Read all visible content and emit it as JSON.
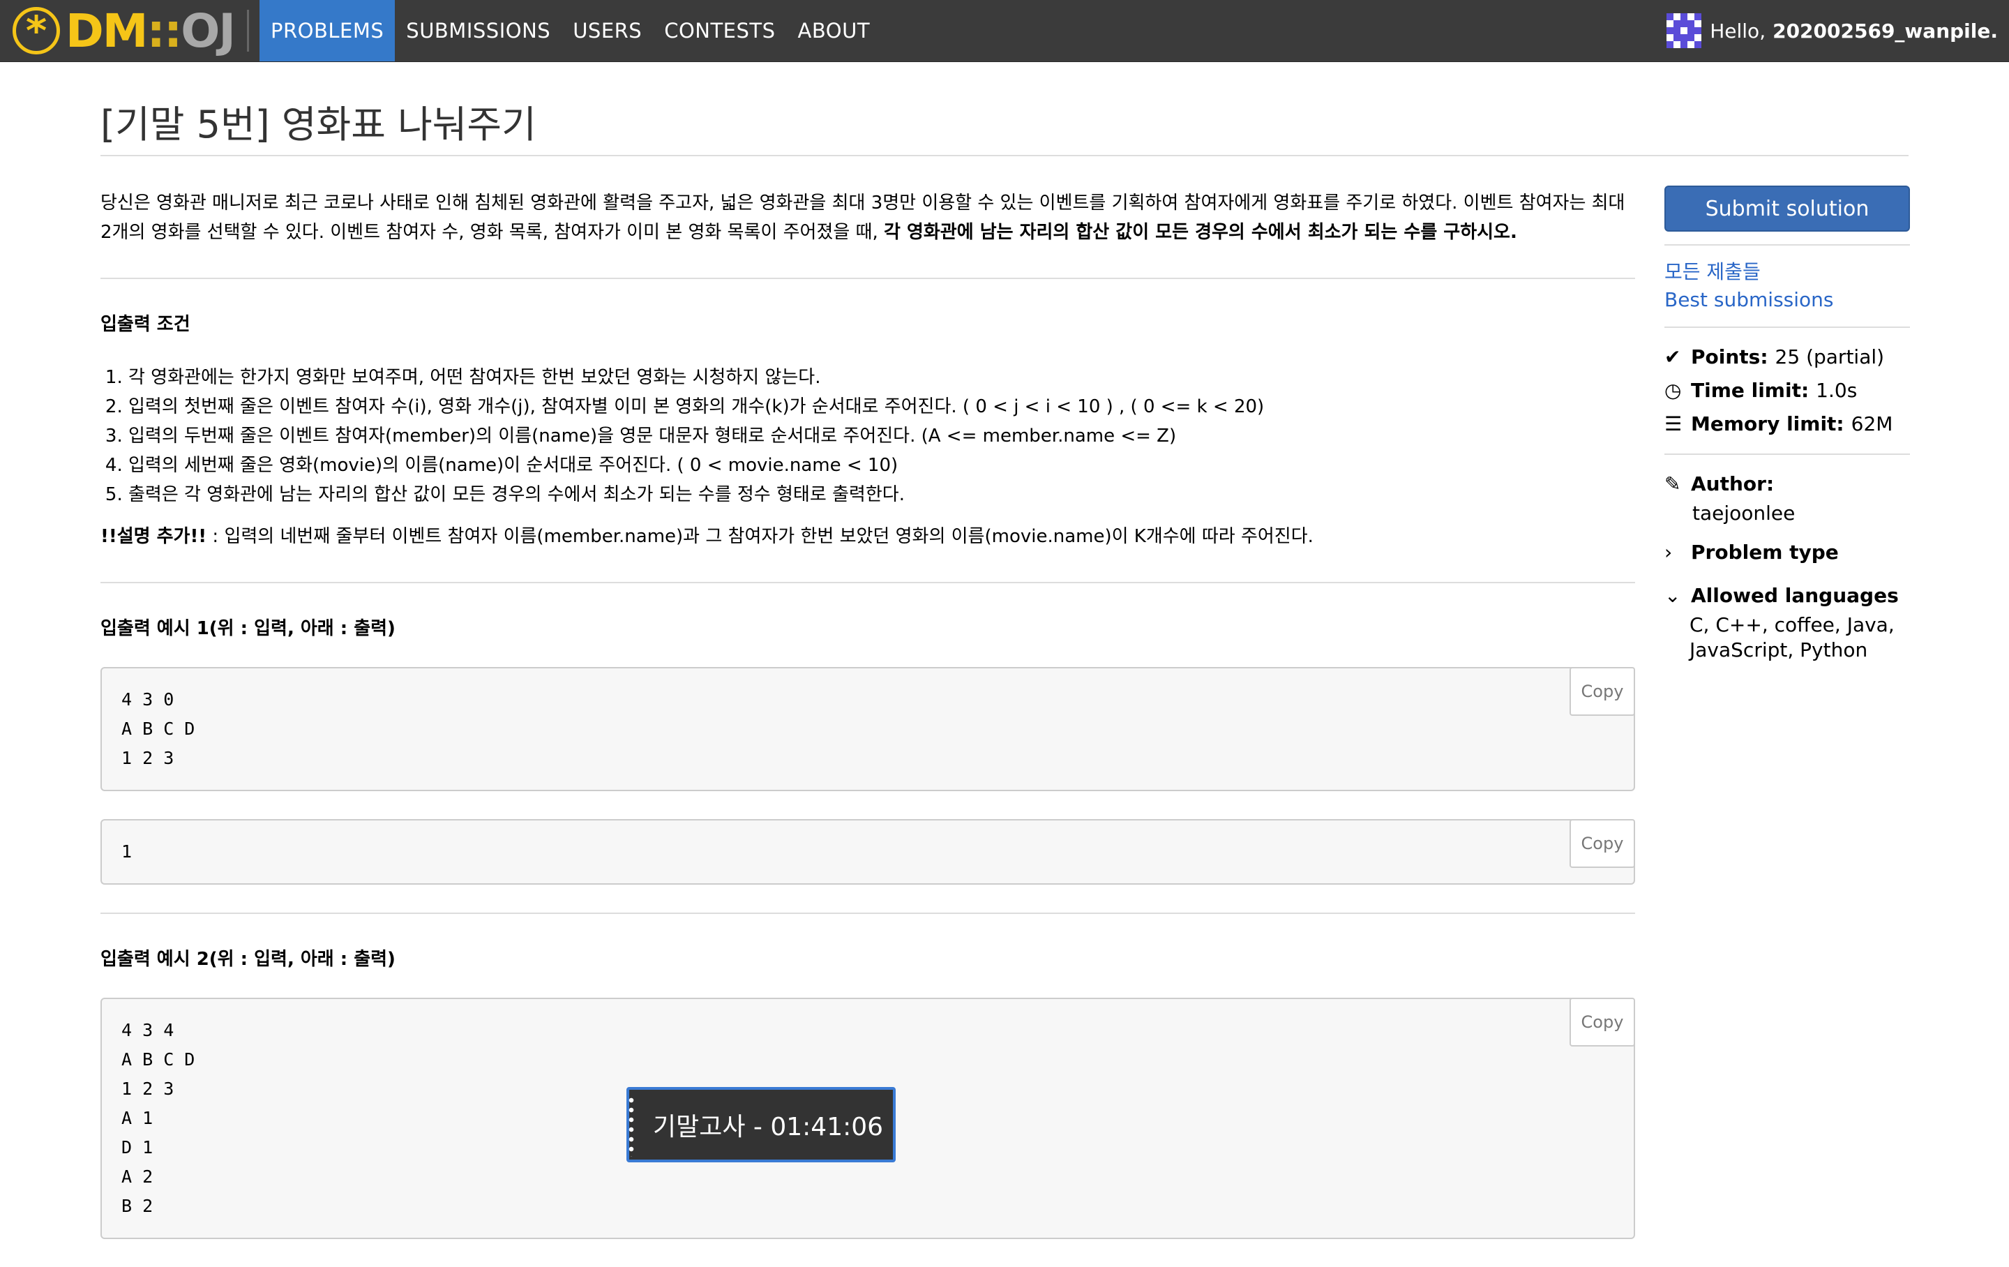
{
  "nav": {
    "logo_dm": "DM",
    "logo_sep": "::",
    "logo_oj": "OJ",
    "items": [
      "PROBLEMS",
      "SUBMISSIONS",
      "USERS",
      "CONTESTS",
      "ABOUT"
    ],
    "greeting": "Hello,",
    "username": "202002569_wanpile."
  },
  "problem": {
    "title": "[기말 5번] 영화표 나눠주기",
    "intro_plain": "당신은 영화관 매니저로 최근 코로나 사태로 인해 침체된 영화관에 활력을 주고자, 넓은 영화관을 최대 3명만 이용할 수 있는 이벤트를 기획하여 참여자에게 영화표를 주기로 하였다. 이벤트 참여자는 최대 2개의 영화를 선택할 수 있다. 이벤트 참여자 수, 영화 목록, 참여자가 이미 본 영화 목록이 주어졌을 때, ",
    "intro_bold": "각 영화관에 남는 자리의 합산 값이 모든 경우의 수에서 최소가 되는 수를 구하시오.",
    "io_heading": "입출력 조건",
    "io_items": [
      "각 영화관에는 한가지 영화만 보여주며, 어떤 참여자든 한번 보았던 영화는 시청하지 않는다.",
      "입력의 첫번째 줄은 이벤트 참여자 수(i), 영화 개수(j), 참여자별 이미 본 영화의 개수(k)가 순서대로 주어진다. ( 0 < j < i < 10 ) , ( 0 <= k < 20)",
      "입력의 두번째 줄은 이벤트 참여자(member)의 이름(name)을 영문 대문자 형태로 순서대로 주어진다. (A <= member.name <= Z)",
      "입력의 세번째 줄은 영화(movie)의 이름(name)이 순서대로 주어진다. ( 0 < movie.name < 10)",
      "출력은 각 영화관에 남는 자리의 합산 값이 모든 경우의 수에서 최소가 되는 수를 정수 형태로 출력한다."
    ],
    "note_bold": "!!설명 추가!!",
    "note_text": " : 입력의 네번째 줄부터 이벤트 참여자 이름(member.name)과 그 참여자가 한번 보았던 영화의 이름(movie.name)이 K개수에 따라 주어진다.",
    "example1_heading": "입출력 예시 1(위 : 입력, 아래 : 출력)",
    "example1_input": "4 3 0\nA B C D\n1 2 3",
    "example1_output": "1",
    "example2_heading": "입출력 예시 2(위 : 입력, 아래 : 출력)",
    "example2_input": "4 3 4\nA B C D\n1 2 3\nA 1\nD 1\nA 2\nB 2",
    "copy_label": "Copy"
  },
  "sidebar": {
    "submit": "Submit solution",
    "link_all": "모든 제출들",
    "link_best": "Best submissions",
    "points_label": "Points:",
    "points_value": "25 (partial)",
    "time_label": "Time limit:",
    "time_value": "1.0s",
    "memory_label": "Memory limit:",
    "memory_value": "62M",
    "author_label": "Author:",
    "author_value": "taejoonlee",
    "problem_type": "Problem type",
    "allowed_label": "Allowed languages",
    "allowed_value": "C, C++, coffee, Java, JavaScript, Python"
  },
  "timer": {
    "text": "기말고사 - 01:41:06"
  },
  "colors": {
    "navbar": "#3b3b3b",
    "nav_active": "#3579c9",
    "logo": "#f5c518",
    "submit_button": "#3a6db5",
    "link": "#2966c7",
    "timer_border": "#3a7bd5"
  }
}
